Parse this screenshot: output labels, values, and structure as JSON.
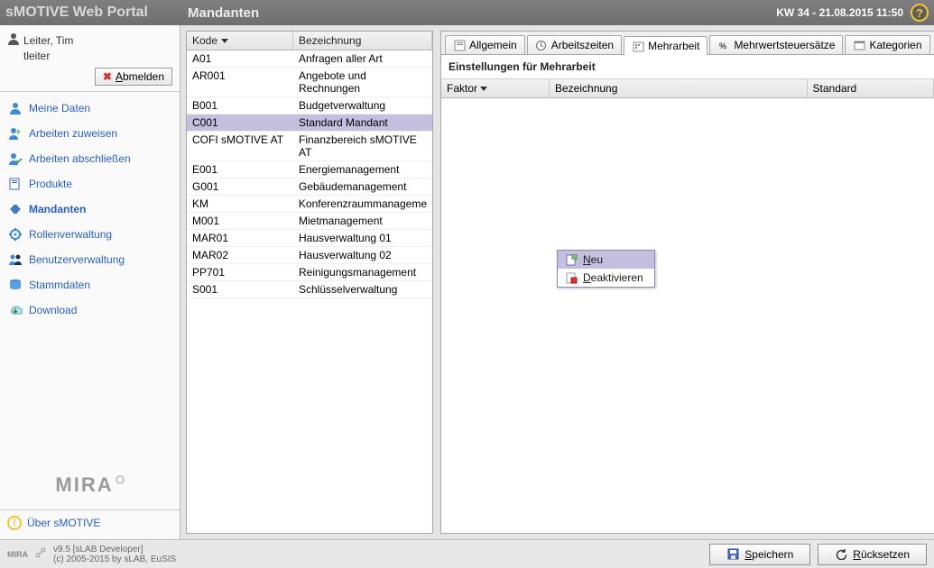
{
  "header": {
    "brand": "sMOTIVE Web Portal",
    "page_title": "Mandanten",
    "datetime": "KW 34 - 21.08.2015 11:50"
  },
  "user": {
    "display_name": "Leiter, Tim",
    "login": "tleiter",
    "logout_label": "Abmelden"
  },
  "nav": {
    "items": [
      {
        "key": "meine-daten",
        "label": "Meine Daten"
      },
      {
        "key": "arbeiten-zuweisen",
        "label": "Arbeiten zuweisen"
      },
      {
        "key": "arbeiten-abschliessen",
        "label": "Arbeiten abschließen"
      },
      {
        "key": "produkte",
        "label": "Produkte"
      },
      {
        "key": "mandanten",
        "label": "Mandanten"
      },
      {
        "key": "rollenverwaltung",
        "label": "Rollenverwaltung"
      },
      {
        "key": "benutzerverwaltung",
        "label": "Benutzerverwaltung"
      },
      {
        "key": "stammdaten",
        "label": "Stammdaten"
      },
      {
        "key": "download",
        "label": "Download"
      }
    ],
    "active": "mandanten",
    "about_label": "Über sMOTIVE",
    "mira_label": "MIRA"
  },
  "left_grid": {
    "columns": {
      "kode": "Kode",
      "bezeichnung": "Bezeichnung"
    },
    "rows": [
      {
        "kode": "A01",
        "bez": "Anfragen aller Art"
      },
      {
        "kode": "AR001",
        "bez": "Angebote und Rechnungen"
      },
      {
        "kode": "B001",
        "bez": "Budgetverwaltung"
      },
      {
        "kode": "C001",
        "bez": "Standard Mandant"
      },
      {
        "kode": "COFI sMOTIVE AT",
        "bez": "Finanzbereich sMOTIVE AT"
      },
      {
        "kode": "E001",
        "bez": "Energiemanagement"
      },
      {
        "kode": "G001",
        "bez": "Gebäudemanagement"
      },
      {
        "kode": "KM",
        "bez": "Konferenzraummanageme"
      },
      {
        "kode": "M001",
        "bez": "Mietmanagement"
      },
      {
        "kode": "MAR01",
        "bez": "Hausverwaltung 01"
      },
      {
        "kode": "MAR02",
        "bez": "Hausverwaltung 02"
      },
      {
        "kode": "PP701",
        "bez": "Reinigungsmanagement"
      },
      {
        "kode": "S001",
        "bez": "Schlüsselverwaltung"
      }
    ],
    "selected_index": 3
  },
  "tabs": {
    "items": [
      {
        "key": "allgemein",
        "label": "Allgemein"
      },
      {
        "key": "arbeitszeiten",
        "label": "Arbeitszeiten"
      },
      {
        "key": "mehrarbeit",
        "label": "Mehrarbeit"
      },
      {
        "key": "mwst",
        "label": "Mehrwertsteuersätze"
      },
      {
        "key": "kategorien",
        "label": "Kategorien"
      }
    ],
    "active": "mehrarbeit"
  },
  "detail": {
    "section_title": "Einstellungen für Mehrarbeit",
    "columns": {
      "faktor": "Faktor",
      "bezeichnung": "Bezeichnung",
      "standard": "Standard"
    }
  },
  "context_menu": {
    "neu": "Neu",
    "deaktivieren": "Deaktivieren",
    "hovered": "neu"
  },
  "footer": {
    "version_line": "v9.5 [sLAB Developer]",
    "copyright": "(c) 2005-2015 by sLAB, EuSIS",
    "save_label": "Speichern",
    "reset_label": "Rücksetzen",
    "logo_text": "MIRA"
  }
}
